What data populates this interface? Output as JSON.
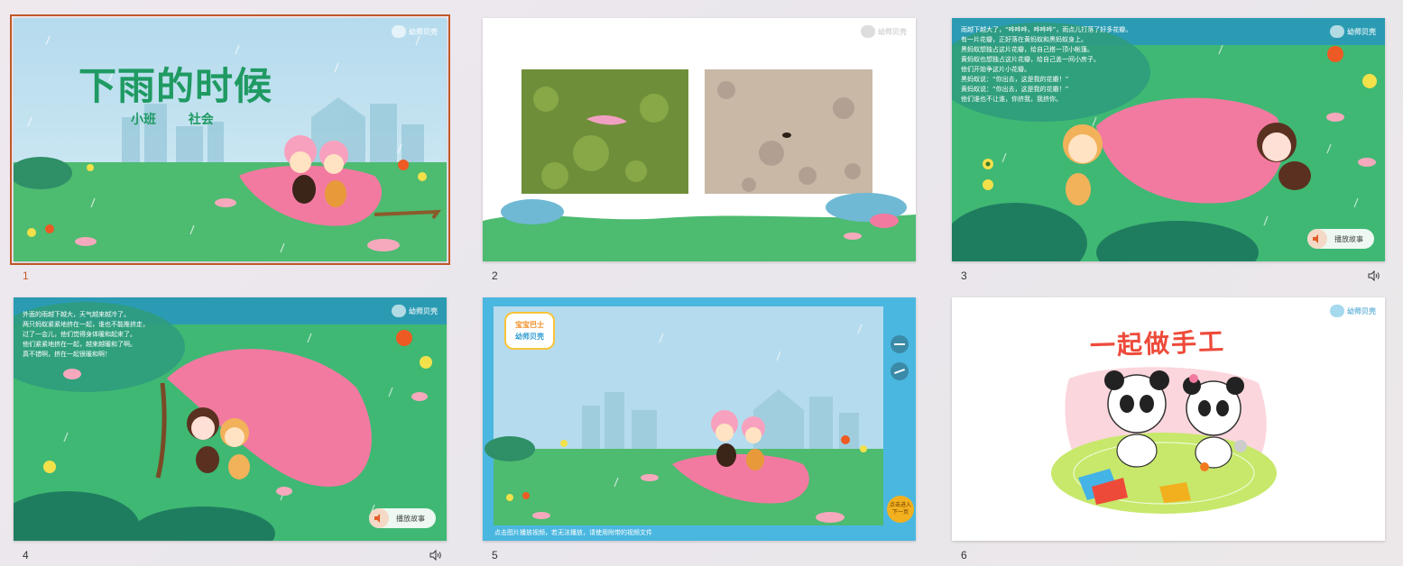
{
  "slides": [
    {
      "number": "1",
      "selected": true,
      "title": "下雨的时候",
      "subtitle_class": "小班",
      "subtitle_subject": "社会",
      "logo_text": "幼师贝壳"
    },
    {
      "number": "2",
      "logo_text": "幼师贝壳"
    },
    {
      "number": "3",
      "has_audio": true,
      "story_text": "雨越下越大了，“哗哗哗，哗哗哗”，雨点儿打落了好多花瓣。\n有一片花瓣，正好落在黄蚂蚁和黑蚂蚁身上。\n黑蚂蚁想独占这片花瓣，给自己搭一顶小帐篷。\n黄蚂蚁也想独占这片花瓣，给自己盖一间小房子。\n他们开始争这片小花瓣。\n黑蚂蚁说：“你出去，这是我的花瓣！”\n黄蚂蚁说：“你出去，这是我的花瓣！”\n他们谁也不让谁，你挤我，我挤你。",
      "play_label": "播放故事",
      "logo_text": "幼师贝壳"
    },
    {
      "number": "4",
      "has_audio": true,
      "story_text": "外面的雨越下越大，天气越来越冷了。\n两只蚂蚁紧紧地挤在一起，谁也不能推挤走，\n过了一会儿，他们觉得身体暖和起来了。\n他们紧紧地挤在一起，越来越暖和了啊。\n真不错啊，挤在一起很暖和啊！",
      "play_label": "播放故事",
      "logo_text": "幼师贝壳"
    },
    {
      "number": "5",
      "brand_line1": "宝宝巴士",
      "brand_line2": "幼师贝壳",
      "notice": "点击图片播放视频，若无法播放，请使用附带的视频文件",
      "next_label_1": "点击进入",
      "next_label_2": "下一页"
    },
    {
      "number": "6",
      "title": "一起做手工",
      "logo_text": "幼师贝壳"
    }
  ],
  "colors": {
    "grass": "#45b96c",
    "sky": "#a9d3ea",
    "title_green": "#1f9a62",
    "petal": "#f27aa0",
    "selected_border": "#c0582a",
    "video_frame": "#4ab7e0",
    "craft_title": "#ee4a3a"
  },
  "icons": [
    "speaker-icon",
    "play-sound-icon",
    "next-arrow-icon"
  ]
}
